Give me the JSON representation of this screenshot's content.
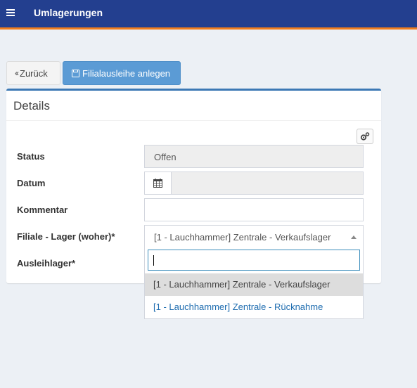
{
  "header": {
    "title": "Umlagerungen"
  },
  "toolbar": {
    "back_label": "Zurück",
    "create_label": "Filialausleihe anlegen"
  },
  "panel": {
    "title": "Details",
    "fields": {
      "status_label": "Status",
      "status_value": "Offen",
      "date_label": "Datum",
      "date_value": "",
      "comment_label": "Kommentar",
      "comment_value": "",
      "source_label": "Filiale - Lager (woher)*",
      "source_value": "[1 - Lauchhammer] Zentrale - Verkaufslager",
      "loan_label": "Ausleihlager*"
    }
  },
  "dropdown": {
    "search_value": "",
    "options": [
      "[1 - Lauchhammer] Zentrale - Verkaufslager",
      "[1 - Lauchhammer] Zentrale - Rücknahme"
    ],
    "highlighted_index": 0
  },
  "icons": {
    "menu": "hamburger-menu-icon",
    "back": "double-chevron-left-icon",
    "save": "floppy-disk-icon",
    "settings": "gears-icon",
    "calendar": "calendar-icon",
    "select": "caret-up-icon"
  },
  "colors": {
    "header_bg": "#233f8f",
    "header_accent": "#f07d1e",
    "primary_button": "#5b9bd5",
    "panel_accent": "#3c78b4",
    "link": "#1f6db0"
  }
}
